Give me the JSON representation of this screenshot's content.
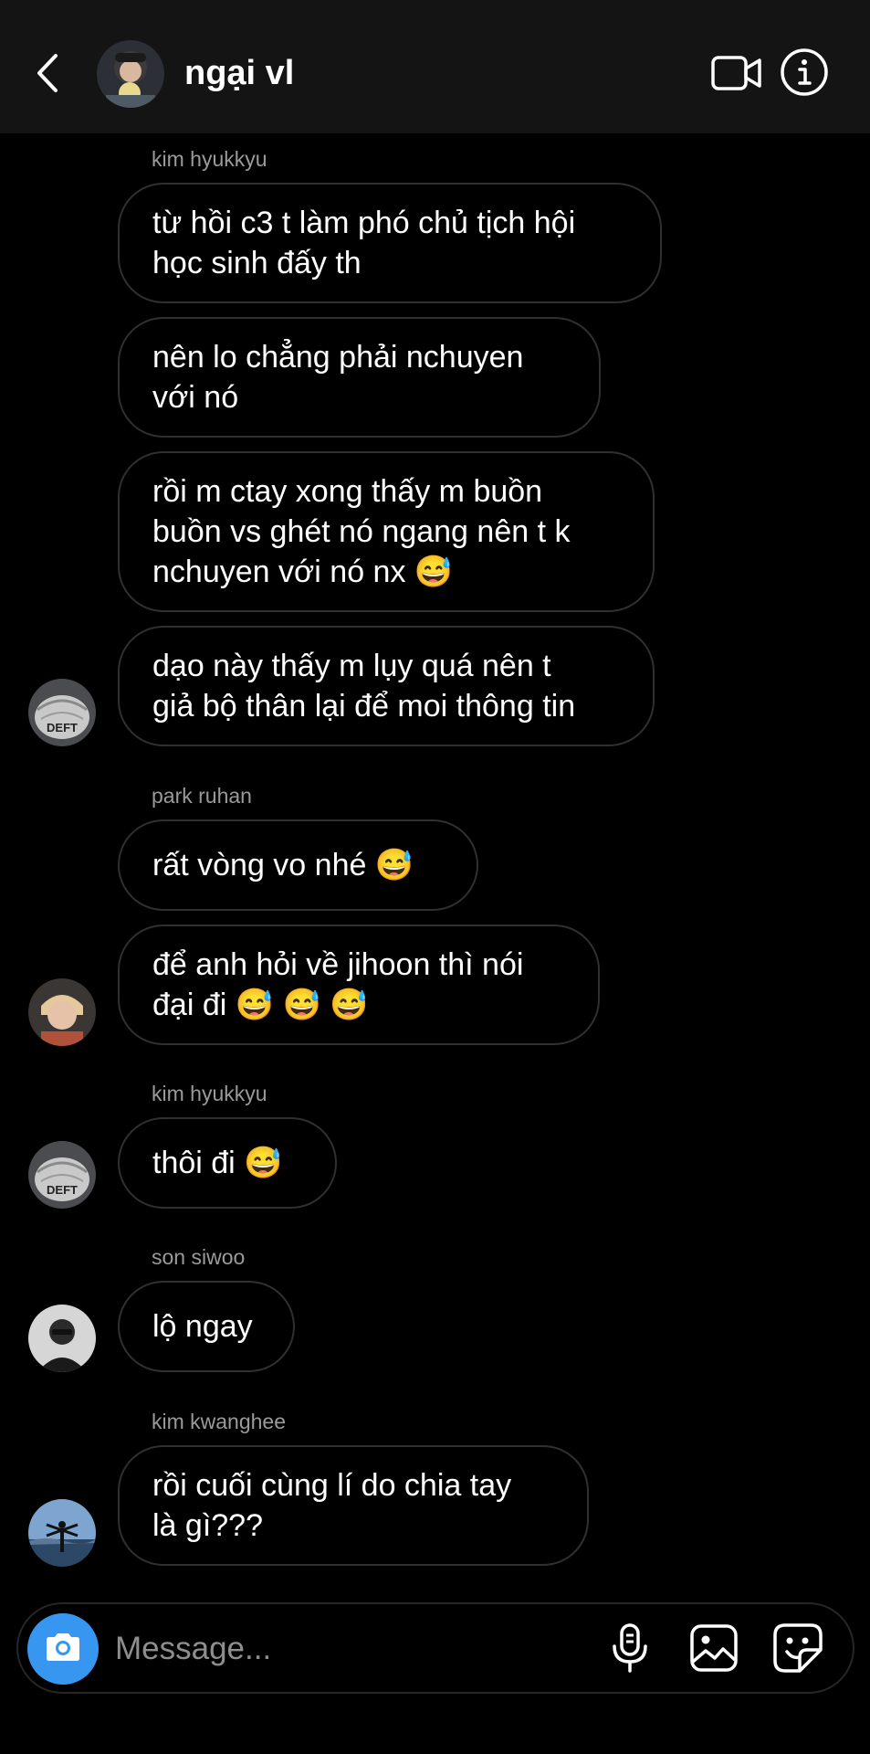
{
  "header": {
    "title": "ngại vl",
    "back_icon": "chevron-left-icon",
    "video_icon": "video-camera-icon",
    "info_icon": "info-icon"
  },
  "messages": [
    {
      "sender": "kim hyukkyu",
      "text": "từ hồi c3 t làm phó chủ tịch hội\nhọc sinh đấy th"
    },
    {
      "text": "nên lo chẳng phải nchuyen\nvới nó"
    },
    {
      "text": "rồi m ctay xong thấy m buồn\nbuồn vs ghét nó ngang nên t k\nnchuyen với nó nx",
      "emoji": "😅"
    },
    {
      "text": "dạo này thấy m lụy quá nên t\ngiả bộ thân lại để moi thông tin"
    },
    {
      "sender": "park ruhan",
      "text": "rất vòng vo nhé",
      "emoji": "😅"
    },
    {
      "text": "để anh hỏi về jihoon thì nói\nđại đi",
      "emoji": "😅 😅 😅"
    },
    {
      "sender": "kim hyukkyu",
      "text": "thôi đi",
      "emoji": "😅"
    },
    {
      "sender": "son siwoo",
      "text": "lộ ngay"
    },
    {
      "sender": "kim kwanghee",
      "text": "rồi cuối cùng lí do chia tay\nlà gì???"
    }
  ],
  "composer": {
    "placeholder": "Message...",
    "camera_icon": "camera-icon",
    "mic_icon": "microphone-icon",
    "gallery_icon": "image-icon",
    "sticker_icon": "sticker-icon"
  },
  "colors": {
    "header_bg": "#141414",
    "bubble_border": "#303030",
    "camera_button": "#3797f0",
    "sender_name": "#9a9a9a"
  }
}
